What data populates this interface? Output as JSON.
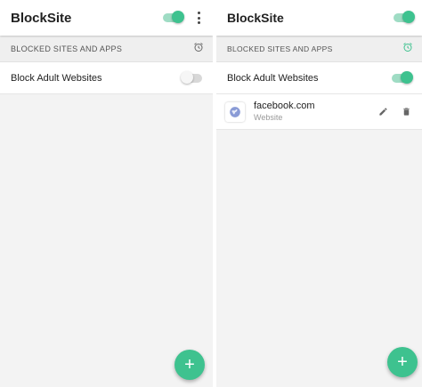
{
  "left_screen": {
    "app_title": "BlockSite",
    "section_label": "BLOCKED SITES AND APPS",
    "adult_row_label": "Block Adult Websites",
    "fab_label": "+"
  },
  "right_screen": {
    "app_title": "BlockSite",
    "section_label": "BLOCKED SITES AND APPS",
    "adult_row_label": "Block Adult Websites",
    "blocked_site": {
      "name": "facebook.com",
      "type": "Website"
    },
    "fab_label": "+"
  },
  "colors": {
    "accent": "#3ec28f",
    "accent_track": "#9fdcc4",
    "background": "#f3f3f3"
  },
  "icons": [
    "more-vert-icon",
    "alarm-clock-icon",
    "globe-icon",
    "edit-pencil-icon",
    "trash-icon"
  ]
}
